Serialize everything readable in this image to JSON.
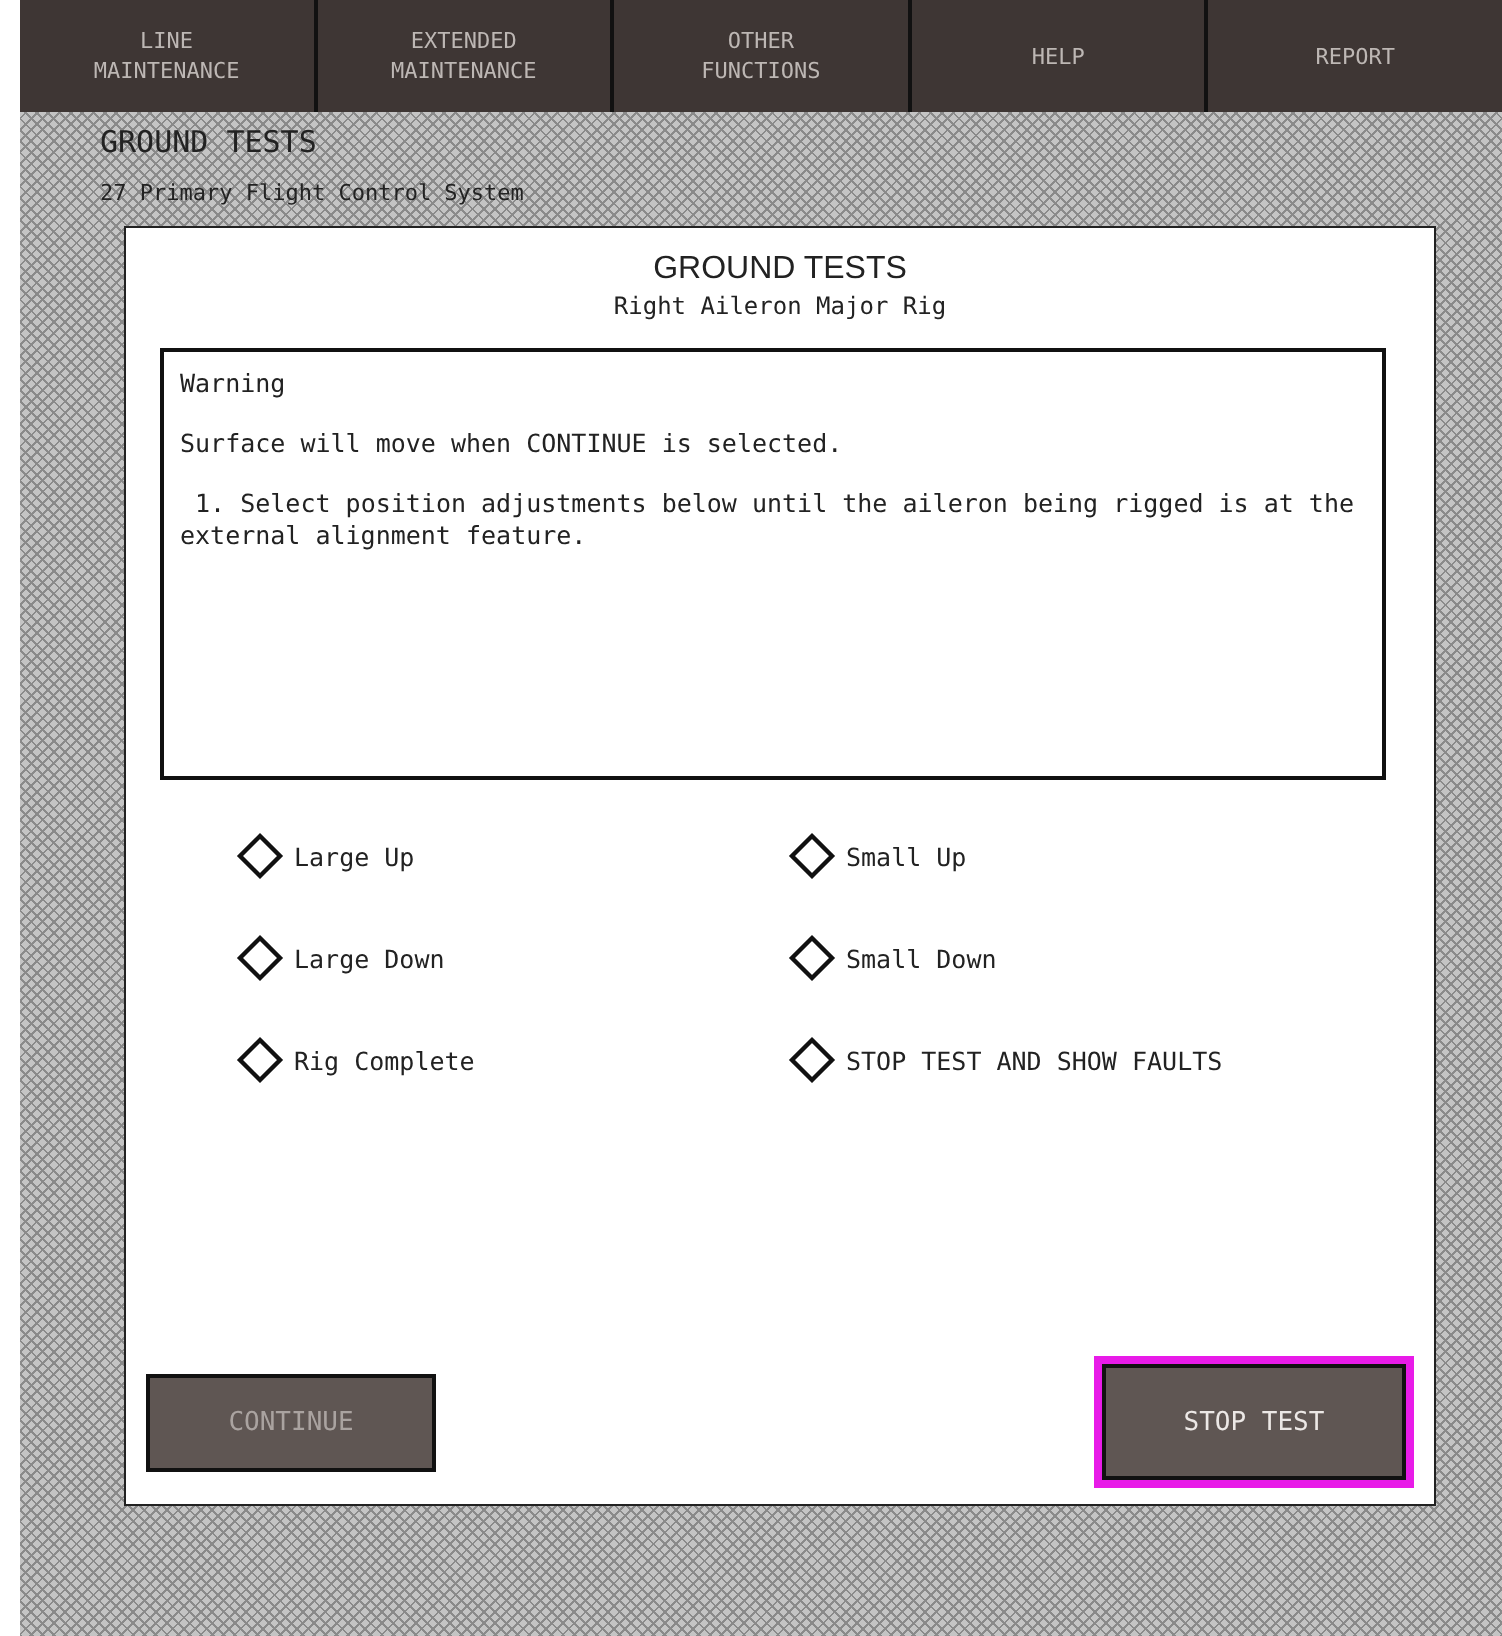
{
  "menu": [
    {
      "label": "LINE\nMAINTENANCE"
    },
    {
      "label": "EXTENDED\nMAINTENANCE"
    },
    {
      "label": "OTHER\nFUNCTIONS"
    },
    {
      "label": "HELP"
    },
    {
      "label": "REPORT"
    }
  ],
  "page_title": "GROUND TESTS",
  "system": "27 Primary Flight Control System",
  "dialog": {
    "title": "GROUND TESTS",
    "subtitle": "Right Aileron Major Rig",
    "message": {
      "heading": "Warning",
      "lines": [
        "Surface will move when CONTINUE is selected.",
        " 1. Select position adjustments below until the aileron being rigged is at the external alignment feature."
      ]
    },
    "options": [
      {
        "label": "Large Up"
      },
      {
        "label": "Small Up"
      },
      {
        "label": "Large Down"
      },
      {
        "label": "Small Down"
      },
      {
        "label": "Rig Complete"
      },
      {
        "label": "STOP TEST AND SHOW FAULTS"
      }
    ],
    "buttons": [
      {
        "label": "CONTINUE",
        "disabled": true,
        "highlighted": false
      },
      {
        "label": "STOP TEST",
        "disabled": false,
        "highlighted": true
      }
    ]
  }
}
